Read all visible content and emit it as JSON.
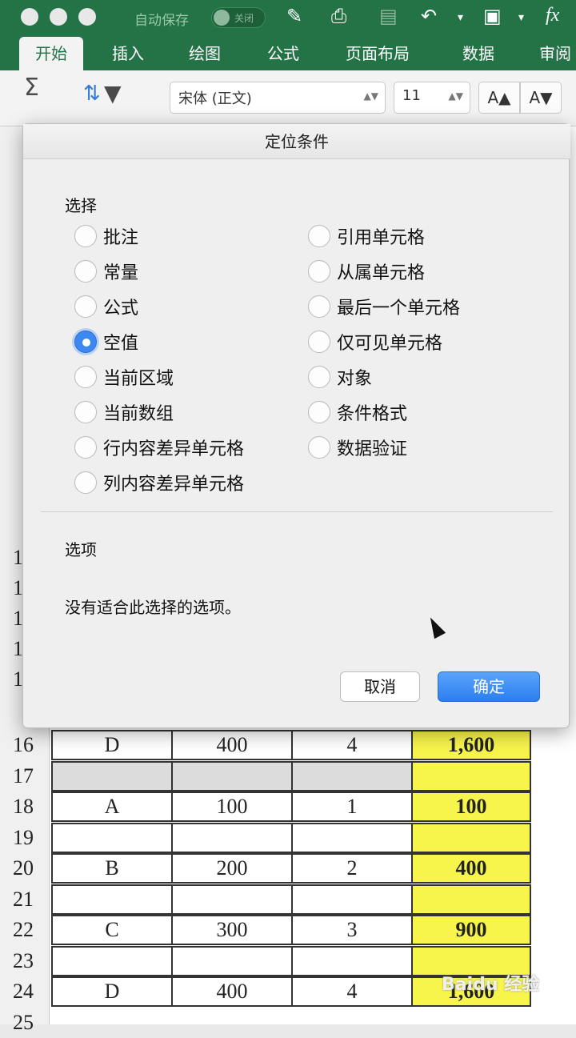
{
  "titlebar": {
    "autosave_label": "自动保存",
    "autosave_state": "关闭",
    "fx_label": "fx"
  },
  "ribbon": {
    "tabs": [
      "开始",
      "插入",
      "绘图",
      "公式",
      "页面布局",
      "数据",
      "审阅"
    ],
    "active_tab": "开始",
    "font_name": "宋体 (正文)",
    "font_size": "11",
    "grow_label": "A▲",
    "shrink_label": "A▼"
  },
  "dialog": {
    "title": "定位条件",
    "select_label": "选择",
    "left_options": [
      "批注",
      "常量",
      "公式",
      "空值",
      "当前区域",
      "当前数组",
      "行内容差异单元格",
      "列内容差异单元格"
    ],
    "right_options": [
      "引用单元格",
      "从属单元格",
      "最后一个单元格",
      "仅可见单元格",
      "对象",
      "条件格式",
      "数据验证"
    ],
    "selected": "空值",
    "options_label": "选项",
    "no_options_text": "没有适合此选择的选项。",
    "cancel_label": "取消",
    "ok_label": "确定"
  },
  "sheet": {
    "rows": [
      {
        "num": "16",
        "cells": [
          "D",
          "400",
          "4",
          "1,600"
        ]
      },
      {
        "num": "17",
        "cells": [
          "",
          "",
          "",
          ""
        ]
      },
      {
        "num": "18",
        "cells": [
          "A",
          "100",
          "1",
          "100"
        ]
      },
      {
        "num": "19",
        "cells": [
          "",
          "",
          "",
          ""
        ]
      },
      {
        "num": "20",
        "cells": [
          "B",
          "200",
          "2",
          "400"
        ]
      },
      {
        "num": "21",
        "cells": [
          "",
          "",
          "",
          ""
        ]
      },
      {
        "num": "22",
        "cells": [
          "C",
          "300",
          "3",
          "900"
        ]
      },
      {
        "num": "23",
        "cells": [
          "",
          "",
          "",
          ""
        ]
      },
      {
        "num": "24",
        "cells": [
          "D",
          "400",
          "4",
          "1,600"
        ]
      },
      {
        "num": "25",
        "cells": [
          "",
          "",
          "",
          ""
        ]
      }
    ],
    "hidden_row_labels": [
      "1",
      "1",
      "1",
      "1",
      "1"
    ]
  },
  "watermark": "Baidu 经验",
  "colors": {
    "excel_green": "#237346",
    "highlight_yellow": "#f7f44c",
    "accent_blue": "#2b7ef0"
  }
}
